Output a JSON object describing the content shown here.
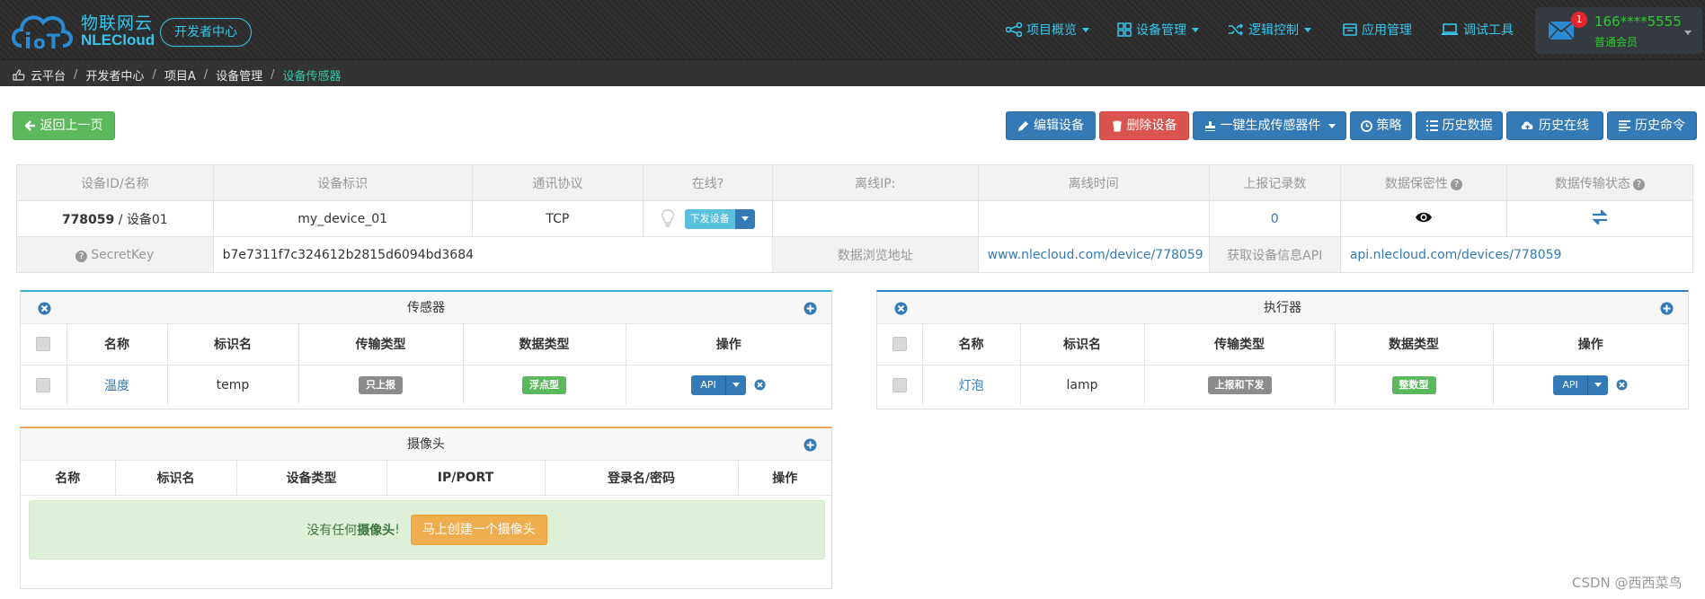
{
  "header": {
    "brand_cn": "物联网云",
    "brand_en": "NLECloud",
    "dev_center": "开发者中心",
    "nav": [
      {
        "label": "项目概览",
        "icon": "share-nodes-icon",
        "dropdown": true
      },
      {
        "label": "设备管理",
        "icon": "grid-icon",
        "dropdown": true
      },
      {
        "label": "逻辑控制",
        "icon": "shuffle-icon",
        "dropdown": true
      },
      {
        "label": "应用管理",
        "icon": "app-box-icon",
        "dropdown": false
      },
      {
        "label": "调试工具",
        "icon": "laptop-icon",
        "dropdown": false
      }
    ],
    "user": {
      "notifications": "1",
      "phone": "166****5555",
      "level": "普通会员"
    }
  },
  "breadcrumb": [
    "云平台",
    "开发者中心",
    "项目A",
    "设备管理",
    "设备传感器"
  ],
  "actions": {
    "back": "返回上一页",
    "edit": "编辑设备",
    "delete": "删除设备",
    "generate": "一键生成传感器件",
    "strategy": "策略",
    "history_data": "历史数据",
    "history_online": "历史在线",
    "history_cmd": "历史命令"
  },
  "device": {
    "headers": [
      "设备ID/名称",
      "设备标识",
      "通讯协议",
      "在线?",
      "离线IP:",
      "离线时间",
      "上报记录数",
      "数据保密性",
      "数据传输状态"
    ],
    "id": "778059",
    "name": " / 设备01",
    "tag": "my_device_01",
    "protocol": "TCP",
    "send_label": "下发设备",
    "ip": "",
    "offline_time": "",
    "report_count": "0",
    "secret_label": "SecretKey",
    "secret_value": "b7e7311f7c324612b2815d6094bd3684",
    "browse_label": "数据浏览地址",
    "browse_url": "www.nlecloud.com/device/778059",
    "api_label": "获取设备信息API",
    "api_url": "api.nlecloud.com/devices/778059"
  },
  "sensors": {
    "title": "传感器",
    "headers": [
      "名称",
      "标识名",
      "传输类型",
      "数据类型",
      "操作"
    ],
    "rows": [
      {
        "name": "温度",
        "tag": "temp",
        "transfer": "只上报",
        "dtype": "浮点型",
        "op": "API"
      }
    ]
  },
  "actuators": {
    "title": "执行器",
    "headers": [
      "名称",
      "标识名",
      "传输类型",
      "数据类型",
      "操作"
    ],
    "rows": [
      {
        "name": "灯泡",
        "tag": "lamp",
        "transfer": "上报和下发",
        "dtype": "整数型",
        "op": "API"
      }
    ]
  },
  "cameras": {
    "title": "摄像头",
    "headers": [
      "名称",
      "标识名",
      "设备类型",
      "IP/PORT",
      "登录名/密码",
      "操作"
    ],
    "empty_prefix": "没有任何",
    "empty_bold": "摄像头",
    "empty_suffix": "!",
    "create_button": "马上创建一个摄像头"
  },
  "watermark": "CSDN @西西菜鸟",
  "colors": {
    "accent": "#38c5ec",
    "green": "#2ec92f",
    "blue": "#337ab7",
    "red": "#d9534f",
    "orange": "#f0ad4e"
  }
}
